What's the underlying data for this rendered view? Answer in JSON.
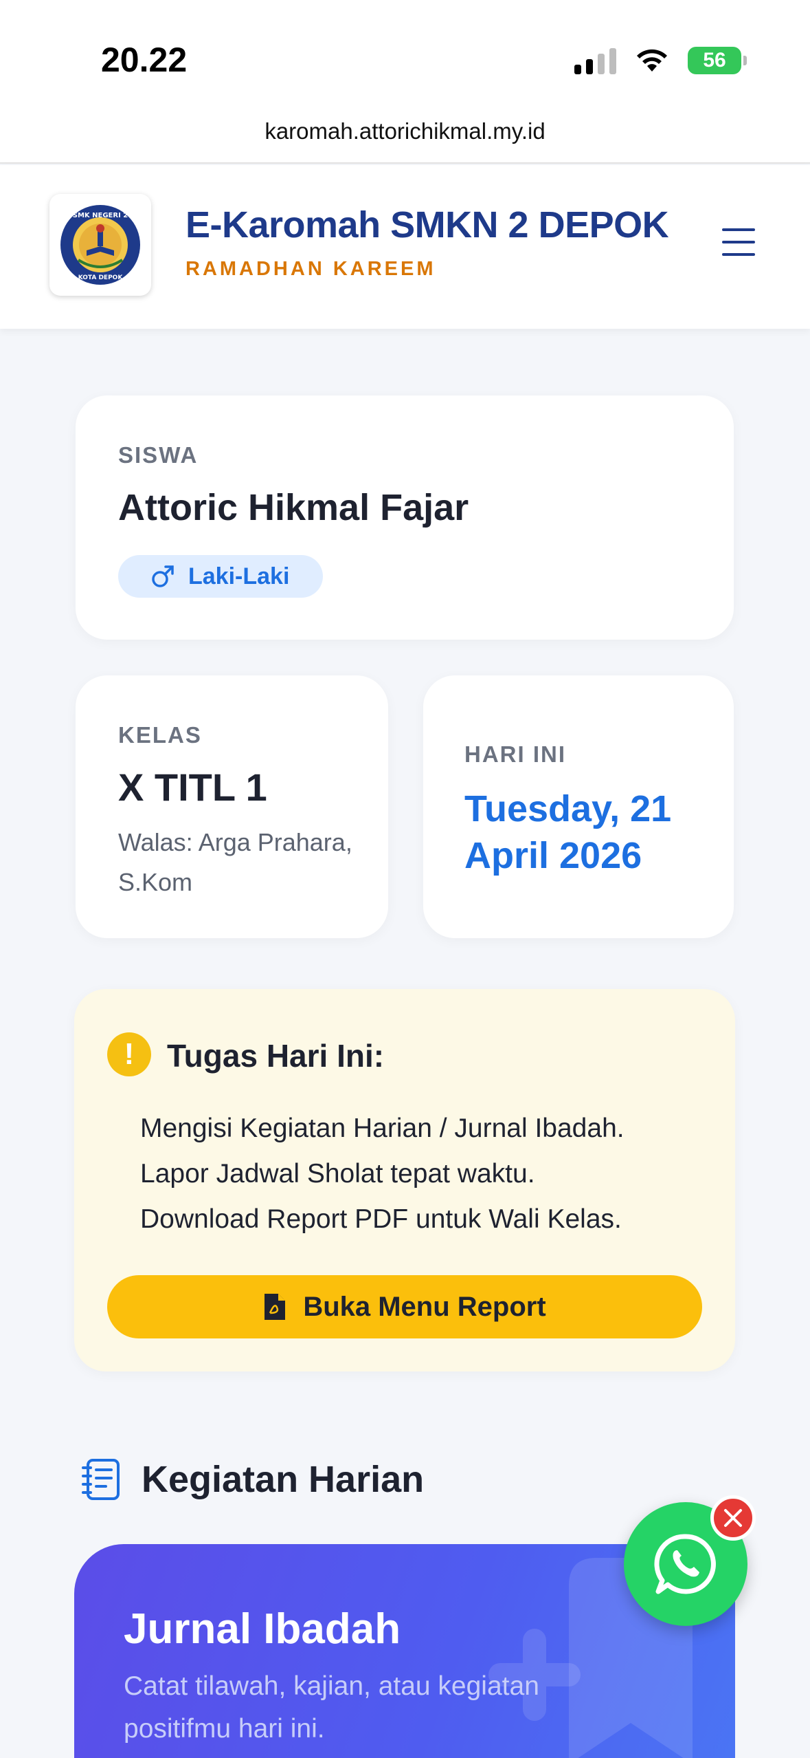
{
  "status_bar": {
    "time": "20.22",
    "battery": "56"
  },
  "browser": {
    "url": "karomah.attorichikmal.my.id"
  },
  "header": {
    "title": "E-Karomah SMKN 2 DEPOK",
    "subtitle": "RAMADHAN KAREEM",
    "logo_ring_text": "SMK NEGERI 2",
    "logo_bottom_text": "KOTA DEPOK"
  },
  "student": {
    "label": "SISWA",
    "name": "Attoric Hikmal Fajar",
    "gender": "Laki-Laki"
  },
  "kelas": {
    "label": "KELAS",
    "value": "X TITL 1",
    "walas": "Walas: Arga Prahara, S.Kom"
  },
  "today": {
    "label": "HARI INI",
    "date": "Tuesday, 21 April 2026"
  },
  "tasks": {
    "title": "Tugas Hari Ini:",
    "items": [
      "Mengisi Kegiatan Harian / Jurnal Ibadah.",
      "Lapor Jadwal Sholat tepat waktu.",
      "Download Report PDF untuk Wali Kelas."
    ],
    "button_label": "Buka Menu Report"
  },
  "section": {
    "title": "Kegiatan Harian"
  },
  "journal": {
    "title": "Jurnal Ibadah",
    "description": "Catat tilawah, kajian, atau kegiatan positifmu hari ini."
  },
  "colors": {
    "brand_navy": "#1e3a8a",
    "accent_orange": "#d97706",
    "link_blue": "#1d6fe0",
    "task_bg": "#fdf9e6",
    "button_yellow": "#fbbf0c",
    "whatsapp_green": "#25d366",
    "journal_purple": "#5b4de8"
  },
  "icons": {
    "signal": "cellular-signal-icon",
    "wifi": "wifi-icon",
    "battery": "battery-charging-icon",
    "menu": "hamburger-menu-icon",
    "gender": "male-symbol-icon",
    "warning": "exclamation-circle-icon",
    "pdf": "pdf-file-icon",
    "section": "notebook-list-icon",
    "whatsapp": "whatsapp-icon",
    "close": "close-icon"
  }
}
